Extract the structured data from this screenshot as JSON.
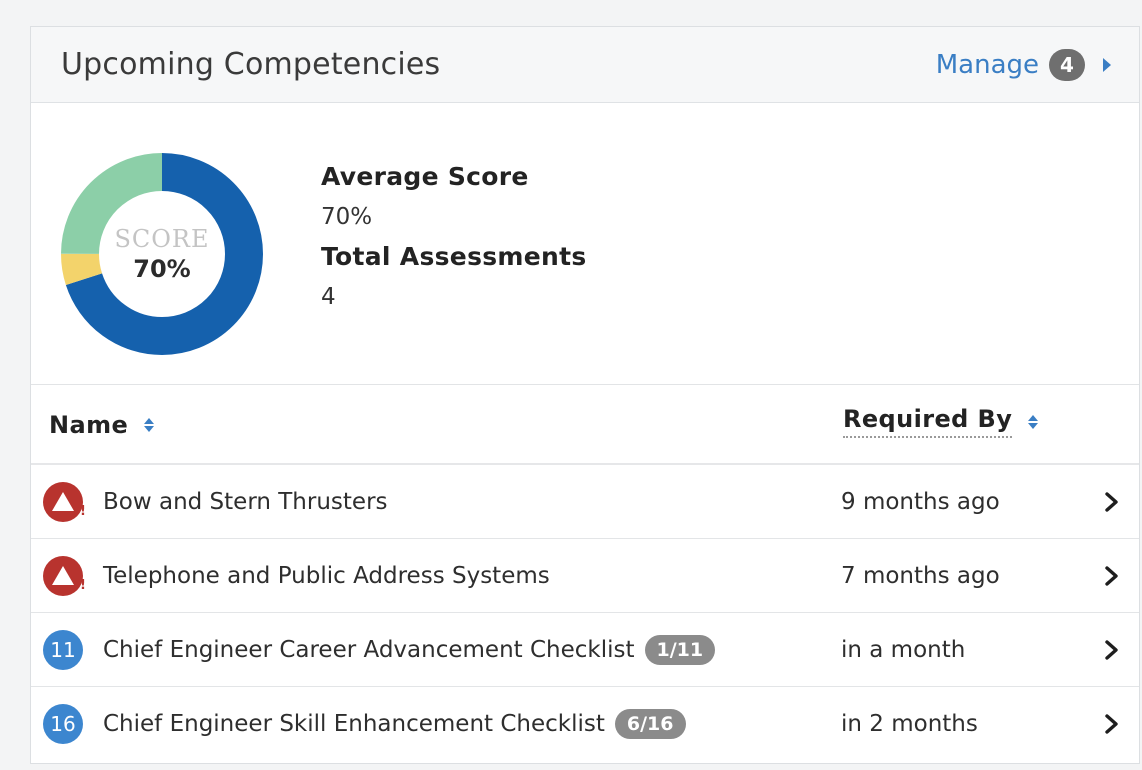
{
  "panel": {
    "title": "Upcoming Competencies",
    "manage_label": "Manage",
    "manage_count": "4"
  },
  "summary": {
    "donut_label": "SCORE",
    "donut_value": "70%",
    "average_score_label": "Average Score",
    "average_score_value": "70%",
    "total_assessments_label": "Total Assessments",
    "total_assessments_value": "4"
  },
  "chart_data": {
    "type": "pie",
    "segments": [
      {
        "value": 70,
        "color": "#1561ad"
      },
      {
        "value": 5,
        "color": "#f3d36b"
      },
      {
        "value": 25,
        "color": "#8ccfa8"
      }
    ]
  },
  "table": {
    "headers": {
      "name": "Name",
      "required_by": "Required By"
    },
    "rows": [
      {
        "icon": "warning-icon",
        "badge": "",
        "name": "Bow and Stern Thrusters",
        "progress": "",
        "required_by": "9 months ago"
      },
      {
        "icon": "warning-icon",
        "badge": "",
        "name": "Telephone and Public Address Systems",
        "progress": "",
        "required_by": "7 months ago"
      },
      {
        "icon": "count-badge",
        "badge": "11",
        "name": "Chief Engineer Career Advancement Checklist",
        "progress": "1/11",
        "required_by": "in a month"
      },
      {
        "icon": "count-badge",
        "badge": "16",
        "name": "Chief Engineer Skill Enhancement Checklist",
        "progress": "6/16",
        "required_by": "in 2 months"
      }
    ]
  },
  "colors": {
    "link": "#3a7ec4",
    "alert": "#b8332e",
    "count": "#3c86cf"
  }
}
